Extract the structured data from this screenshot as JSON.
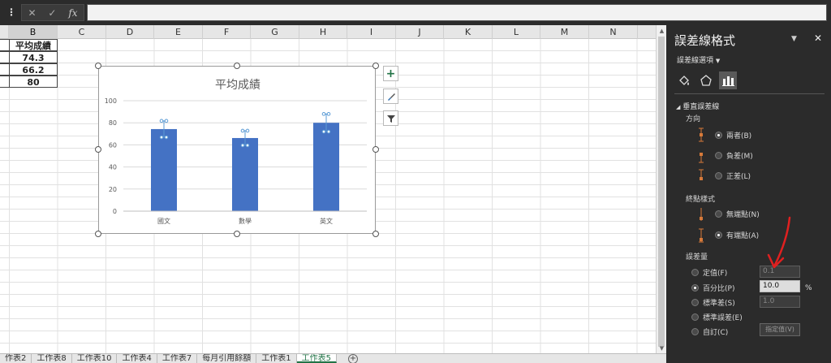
{
  "formula_bar": {
    "cancel_icon": "✕",
    "enter_icon": "✓",
    "fx_label": "fx",
    "value": ""
  },
  "columns": [
    "B",
    "C",
    "D",
    "E",
    "F",
    "G",
    "H",
    "I",
    "J",
    "K",
    "L",
    "M",
    "N"
  ],
  "cells": {
    "header": "平均成績",
    "values": [
      "74.3",
      "66.2",
      "80"
    ]
  },
  "chart_data": {
    "type": "bar",
    "title": "平均成績",
    "categories": [
      "國文",
      "數學",
      "英文"
    ],
    "values": [
      74.3,
      66.2,
      80
    ],
    "error_percent": 10,
    "ylim": [
      0,
      100
    ],
    "yticks": [
      "0",
      "20",
      "40",
      "60",
      "80",
      "100"
    ],
    "bar_color": "#4472c4",
    "error_bar_color": "#5b9bd5",
    "grid": true,
    "legend": "none"
  },
  "chart_buttons": {
    "add_elements": "+",
    "styles": "brush",
    "filter": "funnel"
  },
  "sheet_tabs": [
    "作表2",
    "工作表8",
    "工作表10",
    "工作表4",
    "工作表7",
    "每月引用餘額",
    "工作表1",
    "工作表5"
  ],
  "active_tab": "工作表5",
  "pane": {
    "title": "誤差線格式",
    "subtitle": "誤差線選項",
    "section": "垂直誤差線",
    "direction_label": "方向",
    "direction_options": [
      "兩者(B)",
      "負差(M)",
      "正差(L)"
    ],
    "end_style_label": "終點樣式",
    "end_style_options": [
      "無端點(N)",
      "有端點(A)"
    ],
    "amount_label": "誤差量",
    "amount_options": [
      "定值(F)",
      "百分比(P)",
      "標準差(S)",
      "標準誤差(E)",
      "自訂(C)"
    ],
    "fixed_value": "0.1",
    "percent_value": "10.0",
    "percent_unit": "%",
    "stddev_value": "1.0",
    "custom_button": "指定值(V)"
  },
  "colors": {
    "accent_green": "#217346",
    "annotation_red": "#e02020"
  }
}
